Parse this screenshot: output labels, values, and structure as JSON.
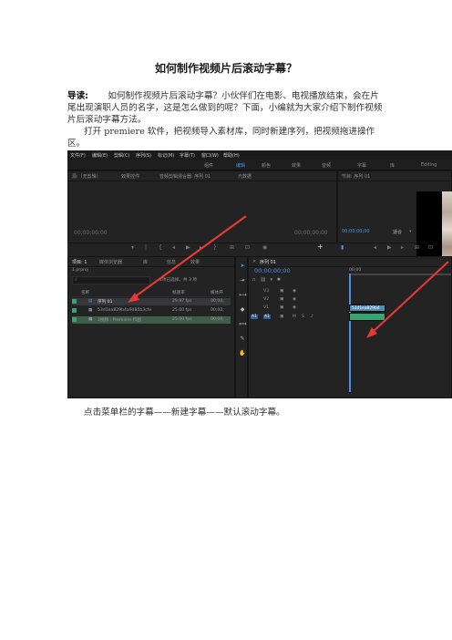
{
  "doc": {
    "title": "如何制作视频片后滚动字幕？",
    "intro_lead": "导读:",
    "intro_text": "如何制作视频片后滚动字幕？小伙伴们在电影、电视播放结束，会在片尾出现演职人员的名字，这是怎么做到的呢？下面，小编就为大家介绍下制作视频片后滚动字幕方法。",
    "step1": "打开 premiere 软件，把视频导入素材库，同时新建序列，把视频拖进操作区。",
    "step2": "点击菜单栏的字幕——新建字幕——默认滚动字幕。"
  },
  "screenshot": {
    "menu": [
      "文件(F)",
      "编辑(E)",
      "剪辑(C)",
      "序列(S)",
      "标记(M)",
      "字幕(T)",
      "窗口(W)",
      "帮助(H)"
    ],
    "workspaces": [
      "组件",
      "编辑",
      "颜色",
      "效果",
      "音频",
      "字幕",
      "库",
      "Editing"
    ],
    "active_workspace": "编辑",
    "source_tabs": [
      "源:（无剪辑）",
      "效果控件",
      "音频剪辑混合器: 序列 01",
      "元数据"
    ],
    "source_timecode_left": "00;00;00;00",
    "source_timecode_right": "00;00;00;00",
    "program_tab": "节目: 序列 01",
    "program_timecode": "00;00;00;00",
    "program_fit": "适合",
    "project_tabs": [
      "项目: 1",
      "媒体浏览器",
      "库",
      "信息",
      "效果"
    ],
    "project_name": "1.prproj",
    "project_count": "1项已选择，共 3 项",
    "project_columns": [
      "名称",
      "帧速率",
      "媒体开"
    ],
    "project_items": [
      {
        "name": "序列 01",
        "fps": "29.97 fps",
        "start": "00;00;"
      },
      {
        "name": "53d1ea829b4a9d85b3cfe",
        "fps": "25.00 fps",
        "start": "00;00;"
      },
      {
        "name": "2视频 - Premiere 作图",
        "fps": "25.00 fps",
        "start": "00;00;"
      }
    ],
    "timeline_tab": "序列 01",
    "timeline_timecode": "00;00;00;00",
    "ruler_start": "00;00",
    "tracks": [
      "V3",
      "V2",
      "V1",
      "A1",
      "A2",
      "A3"
    ],
    "clip_label": "53d1ea829b4"
  },
  "colors": {
    "accent": "#4a8fe7",
    "arrow": "#e53935",
    "clip_video": "#4f8fb8",
    "clip_audio": "#3aa372",
    "playhead": "#4a8fe7"
  }
}
